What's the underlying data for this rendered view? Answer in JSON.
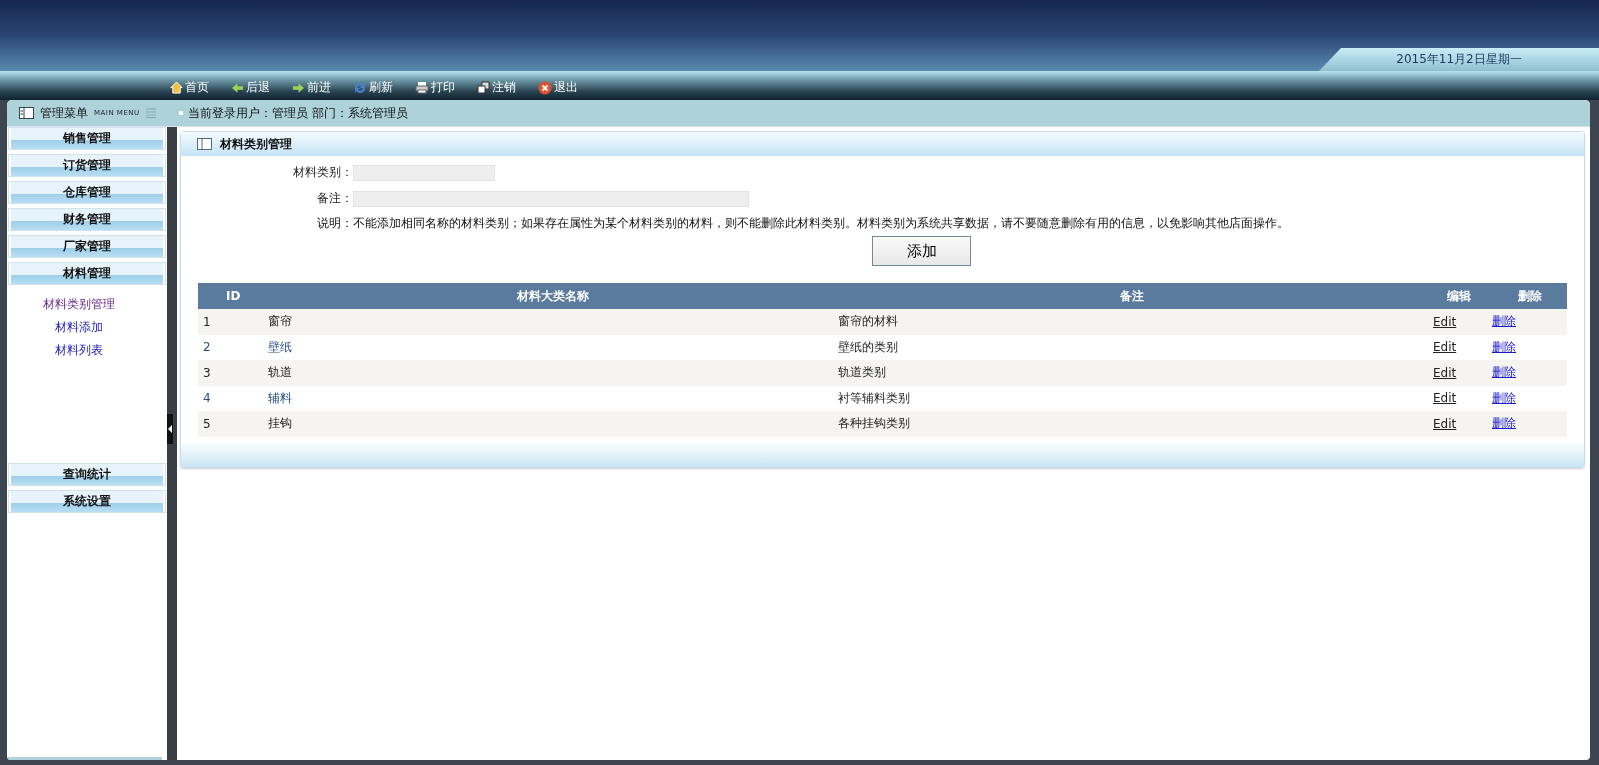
{
  "header": {
    "date": "2015年11月2日星期一"
  },
  "toolbar": [
    {
      "label": "首页"
    },
    {
      "label": "后退"
    },
    {
      "label": "前进"
    },
    {
      "label": "刷新"
    },
    {
      "label": "打印"
    },
    {
      "label": "注销"
    },
    {
      "label": "退出"
    }
  ],
  "sidebar": {
    "title": "管理菜单",
    "subtitle": "MAIN MENU",
    "groups": [
      {
        "label": "销售管理"
      },
      {
        "label": "订货管理"
      },
      {
        "label": "仓库管理"
      },
      {
        "label": "财务管理"
      },
      {
        "label": "厂家管理"
      },
      {
        "label": "材料管理",
        "children": [
          {
            "label": "材料类别管理",
            "selected": true
          },
          {
            "label": "材料添加",
            "selected": false
          },
          {
            "label": "材料列表",
            "selected": false
          }
        ]
      }
    ],
    "bottom_groups": [
      {
        "label": "查询统计"
      },
      {
        "label": "系统设置"
      }
    ]
  },
  "status": "当前登录用户：管理员 部门：系统管理员",
  "panel": {
    "title": "材料类别管理",
    "fields": [
      {
        "label": "材料类别："
      },
      {
        "label": "备注："
      }
    ],
    "note": "说明：不能添加相同名称的材料类别；如果存在属性为某个材料类别的材料，则不能删除此材料类别。材料类别为系统共享数据，请不要随意删除有用的信息，以免影响其他店面操作。",
    "submit": "添加",
    "table": {
      "columns": [
        "ID",
        "材料大类名称",
        "备注",
        "编辑",
        "删除"
      ],
      "rows": [
        {
          "id": "1",
          "name": "窗帘",
          "remark": "窗帘的材料",
          "edit": "Edit",
          "delete": "删除"
        },
        {
          "id": "2",
          "name": "壁纸",
          "remark": "壁纸的类别",
          "edit": "Edit",
          "delete": "删除"
        },
        {
          "id": "3",
          "name": "轨道",
          "remark": "轨道类别",
          "edit": "Edit",
          "delete": "删除"
        },
        {
          "id": "4",
          "name": "辅料",
          "remark": "衬等辅料类别",
          "edit": "Edit",
          "delete": "删除"
        },
        {
          "id": "5",
          "name": "挂钩",
          "remark": "各种挂钩类别",
          "edit": "Edit",
          "delete": "删除"
        }
      ]
    }
  }
}
